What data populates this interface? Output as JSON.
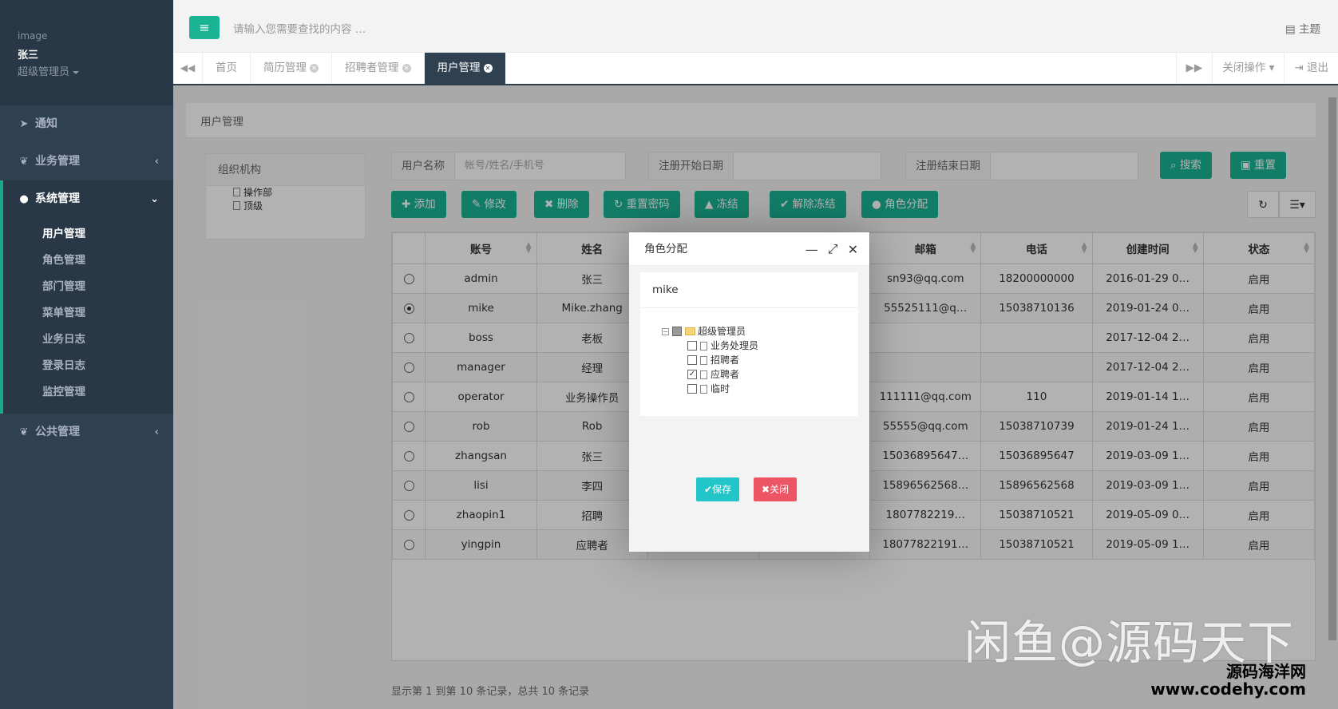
{
  "sidebar": {
    "image_label": "image",
    "user_name": "张三",
    "user_role": "超级管理员",
    "nav": [
      {
        "label": "通知",
        "icon": "paper-plane-icon"
      },
      {
        "label": "业务管理",
        "icon": "leaf-icon",
        "arrow": "‹"
      },
      {
        "label": "系统管理",
        "icon": "user-icon",
        "arrow": "⌄"
      },
      {
        "label": "公共管理",
        "icon": "leaf-icon",
        "arrow": "‹"
      }
    ],
    "sub_items": [
      "用户管理",
      "角色管理",
      "部门管理",
      "菜单管理",
      "业务日志",
      "登录日志",
      "监控管理"
    ]
  },
  "topbar": {
    "menu_icon": "≡",
    "search_placeholder": "请输入您需要查找的内容 …",
    "theme_label": "主题"
  },
  "tabs": {
    "items": [
      {
        "label": "首页",
        "closable": false
      },
      {
        "label": "简历管理",
        "closable": true
      },
      {
        "label": "招聘者管理",
        "closable": true
      },
      {
        "label": "用户管理",
        "closable": true,
        "active": true
      }
    ],
    "close_ops": "关闭操作",
    "logout": "退出"
  },
  "page": {
    "title": "用户管理",
    "org_title": "组织机构",
    "org_nodes": [
      "操作部",
      "顶级"
    ],
    "filters": {
      "username_label": "用户名称",
      "username_placeholder": "帐号/姓名/手机号",
      "start_label": "注册开始日期",
      "end_label": "注册结束日期"
    },
    "search_btn": "搜索",
    "reset_btn": "重置",
    "toolbar": [
      "添加",
      "修改",
      "删除",
      "重置密码",
      "冻结",
      "解除冻结",
      "角色分配"
    ],
    "columns": [
      "账号",
      "姓名",
      "",
      "",
      "邮箱",
      "电话",
      "创建时间",
      "状态"
    ],
    "rows": [
      {
        "selected": false,
        "account": "admin",
        "name": "张三",
        "email": "sn93@qq.com",
        "phone": "18200000000",
        "created": "2016-01-29 0…",
        "status": "启用"
      },
      {
        "selected": true,
        "account": "mike",
        "name": "Mike.zhang",
        "email": "55525111@q…",
        "phone": "15038710136",
        "created": "2019-01-24 0…",
        "status": "启用"
      },
      {
        "selected": false,
        "account": "boss",
        "name": "老板",
        "email": "",
        "phone": "",
        "created": "2017-12-04 2…",
        "status": "启用"
      },
      {
        "selected": false,
        "account": "manager",
        "name": "经理",
        "email": "",
        "phone": "",
        "created": "2017-12-04 2…",
        "status": "启用"
      },
      {
        "selected": false,
        "account": "operator",
        "name": "业务操作员",
        "email": "111111@qq.com",
        "phone": "110",
        "created": "2019-01-14 1…",
        "status": "启用"
      },
      {
        "selected": false,
        "account": "rob",
        "name": "Rob",
        "email": "55555@qq.com",
        "phone": "15038710739",
        "created": "2019-01-24 1…",
        "status": "启用"
      },
      {
        "selected": false,
        "account": "zhangsan",
        "name": "张三",
        "email": "15036895647…",
        "phone": "15036895647",
        "created": "2019-03-09 1…",
        "status": "启用"
      },
      {
        "selected": false,
        "account": "lisi",
        "name": "李四",
        "email": "15896562568…",
        "phone": "15896562568",
        "created": "2019-03-09 1…",
        "status": "启用"
      },
      {
        "selected": false,
        "account": "zhaopin1",
        "name": "招聘",
        "email": "1807782219…",
        "phone": "15038710521",
        "created": "2019-05-09 0…",
        "status": "启用"
      },
      {
        "selected": false,
        "account": "yingpin",
        "name": "应聘者",
        "email": "18077822191…",
        "phone": "15038710521",
        "created": "2019-05-09 1…",
        "status": "启用"
      }
    ],
    "footer": "显示第 1 到第 10 条记录，总共 10 条记录"
  },
  "modal": {
    "title": "角色分配",
    "user": "mike",
    "root_role": "超级管理员",
    "roles": [
      {
        "label": "业务处理员",
        "checked": false
      },
      {
        "label": "招聘者",
        "checked": false
      },
      {
        "label": "应聘者",
        "checked": true
      },
      {
        "label": "临时",
        "checked": false
      }
    ],
    "save_btn": "保存",
    "close_btn": "关闭"
  },
  "watermark": {
    "main": "闲鱼@源码天下",
    "site_name": "源码海洋网",
    "site_url": "www.codehy.com"
  },
  "colors": {
    "primary": "#1ab394",
    "sidebar": "#2f4050",
    "danger": "#ed5565",
    "info": "#23c6c8"
  }
}
